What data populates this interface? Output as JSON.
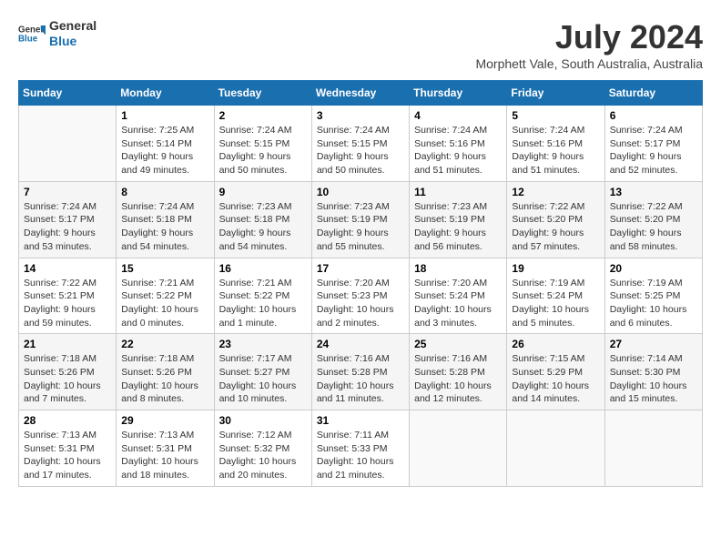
{
  "header": {
    "logo": {
      "line1": "General",
      "line2": "Blue"
    },
    "title": "July 2024",
    "subtitle": "Morphett Vale, South Australia, Australia"
  },
  "weekdays": [
    "Sunday",
    "Monday",
    "Tuesday",
    "Wednesday",
    "Thursday",
    "Friday",
    "Saturday"
  ],
  "weeks": [
    [
      {
        "day": "",
        "info": ""
      },
      {
        "day": "1",
        "info": "Sunrise: 7:25 AM\nSunset: 5:14 PM\nDaylight: 9 hours\nand 49 minutes."
      },
      {
        "day": "2",
        "info": "Sunrise: 7:24 AM\nSunset: 5:15 PM\nDaylight: 9 hours\nand 50 minutes."
      },
      {
        "day": "3",
        "info": "Sunrise: 7:24 AM\nSunset: 5:15 PM\nDaylight: 9 hours\nand 50 minutes."
      },
      {
        "day": "4",
        "info": "Sunrise: 7:24 AM\nSunset: 5:16 PM\nDaylight: 9 hours\nand 51 minutes."
      },
      {
        "day": "5",
        "info": "Sunrise: 7:24 AM\nSunset: 5:16 PM\nDaylight: 9 hours\nand 51 minutes."
      },
      {
        "day": "6",
        "info": "Sunrise: 7:24 AM\nSunset: 5:17 PM\nDaylight: 9 hours\nand 52 minutes."
      }
    ],
    [
      {
        "day": "7",
        "info": "Sunrise: 7:24 AM\nSunset: 5:17 PM\nDaylight: 9 hours\nand 53 minutes."
      },
      {
        "day": "8",
        "info": "Sunrise: 7:24 AM\nSunset: 5:18 PM\nDaylight: 9 hours\nand 54 minutes."
      },
      {
        "day": "9",
        "info": "Sunrise: 7:23 AM\nSunset: 5:18 PM\nDaylight: 9 hours\nand 54 minutes."
      },
      {
        "day": "10",
        "info": "Sunrise: 7:23 AM\nSunset: 5:19 PM\nDaylight: 9 hours\nand 55 minutes."
      },
      {
        "day": "11",
        "info": "Sunrise: 7:23 AM\nSunset: 5:19 PM\nDaylight: 9 hours\nand 56 minutes."
      },
      {
        "day": "12",
        "info": "Sunrise: 7:22 AM\nSunset: 5:20 PM\nDaylight: 9 hours\nand 57 minutes."
      },
      {
        "day": "13",
        "info": "Sunrise: 7:22 AM\nSunset: 5:20 PM\nDaylight: 9 hours\nand 58 minutes."
      }
    ],
    [
      {
        "day": "14",
        "info": "Sunrise: 7:22 AM\nSunset: 5:21 PM\nDaylight: 9 hours\nand 59 minutes."
      },
      {
        "day": "15",
        "info": "Sunrise: 7:21 AM\nSunset: 5:22 PM\nDaylight: 10 hours\nand 0 minutes."
      },
      {
        "day": "16",
        "info": "Sunrise: 7:21 AM\nSunset: 5:22 PM\nDaylight: 10 hours\nand 1 minute."
      },
      {
        "day": "17",
        "info": "Sunrise: 7:20 AM\nSunset: 5:23 PM\nDaylight: 10 hours\nand 2 minutes."
      },
      {
        "day": "18",
        "info": "Sunrise: 7:20 AM\nSunset: 5:24 PM\nDaylight: 10 hours\nand 3 minutes."
      },
      {
        "day": "19",
        "info": "Sunrise: 7:19 AM\nSunset: 5:24 PM\nDaylight: 10 hours\nand 5 minutes."
      },
      {
        "day": "20",
        "info": "Sunrise: 7:19 AM\nSunset: 5:25 PM\nDaylight: 10 hours\nand 6 minutes."
      }
    ],
    [
      {
        "day": "21",
        "info": "Sunrise: 7:18 AM\nSunset: 5:26 PM\nDaylight: 10 hours\nand 7 minutes."
      },
      {
        "day": "22",
        "info": "Sunrise: 7:18 AM\nSunset: 5:26 PM\nDaylight: 10 hours\nand 8 minutes."
      },
      {
        "day": "23",
        "info": "Sunrise: 7:17 AM\nSunset: 5:27 PM\nDaylight: 10 hours\nand 10 minutes."
      },
      {
        "day": "24",
        "info": "Sunrise: 7:16 AM\nSunset: 5:28 PM\nDaylight: 10 hours\nand 11 minutes."
      },
      {
        "day": "25",
        "info": "Sunrise: 7:16 AM\nSunset: 5:28 PM\nDaylight: 10 hours\nand 12 minutes."
      },
      {
        "day": "26",
        "info": "Sunrise: 7:15 AM\nSunset: 5:29 PM\nDaylight: 10 hours\nand 14 minutes."
      },
      {
        "day": "27",
        "info": "Sunrise: 7:14 AM\nSunset: 5:30 PM\nDaylight: 10 hours\nand 15 minutes."
      }
    ],
    [
      {
        "day": "28",
        "info": "Sunrise: 7:13 AM\nSunset: 5:31 PM\nDaylight: 10 hours\nand 17 minutes."
      },
      {
        "day": "29",
        "info": "Sunrise: 7:13 AM\nSunset: 5:31 PM\nDaylight: 10 hours\nand 18 minutes."
      },
      {
        "day": "30",
        "info": "Sunrise: 7:12 AM\nSunset: 5:32 PM\nDaylight: 10 hours\nand 20 minutes."
      },
      {
        "day": "31",
        "info": "Sunrise: 7:11 AM\nSunset: 5:33 PM\nDaylight: 10 hours\nand 21 minutes."
      },
      {
        "day": "",
        "info": ""
      },
      {
        "day": "",
        "info": ""
      },
      {
        "day": "",
        "info": ""
      }
    ]
  ]
}
